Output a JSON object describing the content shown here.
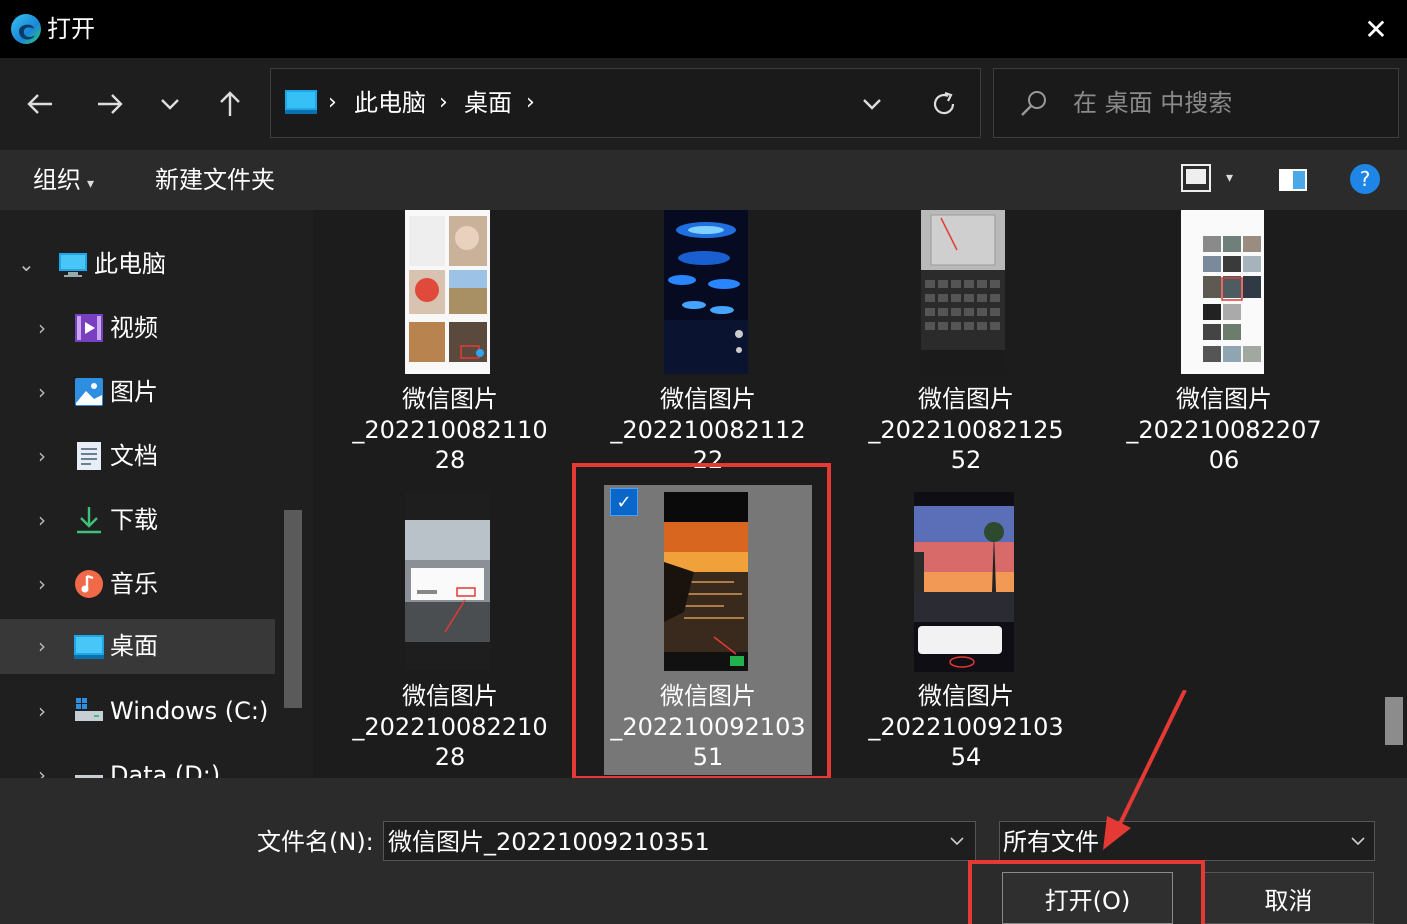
{
  "window": {
    "title": "打开",
    "close_glyph": "✕"
  },
  "nav": {
    "back_icon": "back-arrow-icon",
    "forward_icon": "forward-arrow-icon",
    "recent_icon": "chevron-down-icon",
    "up_icon": "up-arrow-icon"
  },
  "address": {
    "crumbs": [
      "此电脑",
      "桌面"
    ],
    "separator": "›"
  },
  "search": {
    "placeholder": "在 桌面 中搜索"
  },
  "toolbar": {
    "organize": "组织",
    "new_folder": "新建文件夹"
  },
  "sidebar": {
    "items": [
      {
        "label": "此电脑",
        "icon": "computer-icon",
        "expanded": true
      },
      {
        "label": "视频",
        "icon": "video-icon"
      },
      {
        "label": "图片",
        "icon": "pictures-icon"
      },
      {
        "label": "文档",
        "icon": "documents-icon"
      },
      {
        "label": "下载",
        "icon": "download-icon"
      },
      {
        "label": "音乐",
        "icon": "music-icon"
      },
      {
        "label": "桌面",
        "icon": "desktop-icon",
        "selected": true
      },
      {
        "label": "Windows (C:)",
        "icon": "drive-icon"
      },
      {
        "label": "Data (D:)",
        "icon": "drive-icon"
      }
    ]
  },
  "files": [
    {
      "line1": "微信图片",
      "line2": "_202210082110",
      "line3": "28"
    },
    {
      "line1": "微信图片",
      "line2": "_202210082112",
      "line3": "22"
    },
    {
      "line1": "微信图片",
      "line2": "_202210082125",
      "line3": "52"
    },
    {
      "line1": "微信图片",
      "line2": "_202210082207",
      "line3": "06"
    },
    {
      "line1": "微信图片",
      "line2": "_202210082210",
      "line3": "28"
    },
    {
      "line1": "微信图片",
      "line2": "_202210092103",
      "line3": "51",
      "selected": true
    },
    {
      "line1": "微信图片",
      "line2": "_202210092103",
      "line3": "54"
    }
  ],
  "bottom": {
    "filename_label": "文件名(N):",
    "filename_value": "微信图片_20221009210351",
    "filetype_value": "所有文件",
    "open_label": "打开(O)",
    "cancel_label": "取消"
  },
  "colors": {
    "accent": "#0a67c9",
    "annotation": "#e53935"
  }
}
